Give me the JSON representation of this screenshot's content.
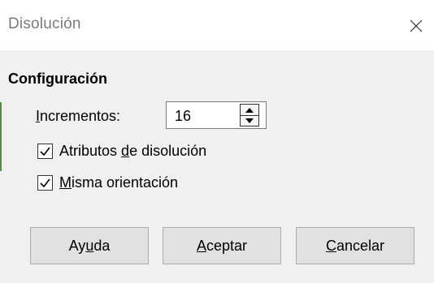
{
  "window": {
    "title": "Disolución"
  },
  "section": {
    "title": "Configuración"
  },
  "increments": {
    "label_mnemonic": "I",
    "label_rest": "ncrementos:",
    "value": "16"
  },
  "checkboxes": [
    {
      "label_before": "Atributos ",
      "label_mnemonic": "d",
      "label_after": "e disolución",
      "checked": true
    },
    {
      "label_before": "",
      "label_mnemonic": "M",
      "label_after": "isma orientación",
      "checked": true
    }
  ],
  "buttons": {
    "help": {
      "before": "Ay",
      "mnemonic": "u",
      "after": "da"
    },
    "ok": {
      "before": "",
      "mnemonic": "A",
      "after": "ceptar"
    },
    "cancel": {
      "before": "",
      "mnemonic": "C",
      "after": "ancelar"
    }
  },
  "icons": {
    "close": "close-icon",
    "spin_up": "triangle-up-icon",
    "spin_down": "triangle-down-icon",
    "check": "checkmark-icon"
  }
}
